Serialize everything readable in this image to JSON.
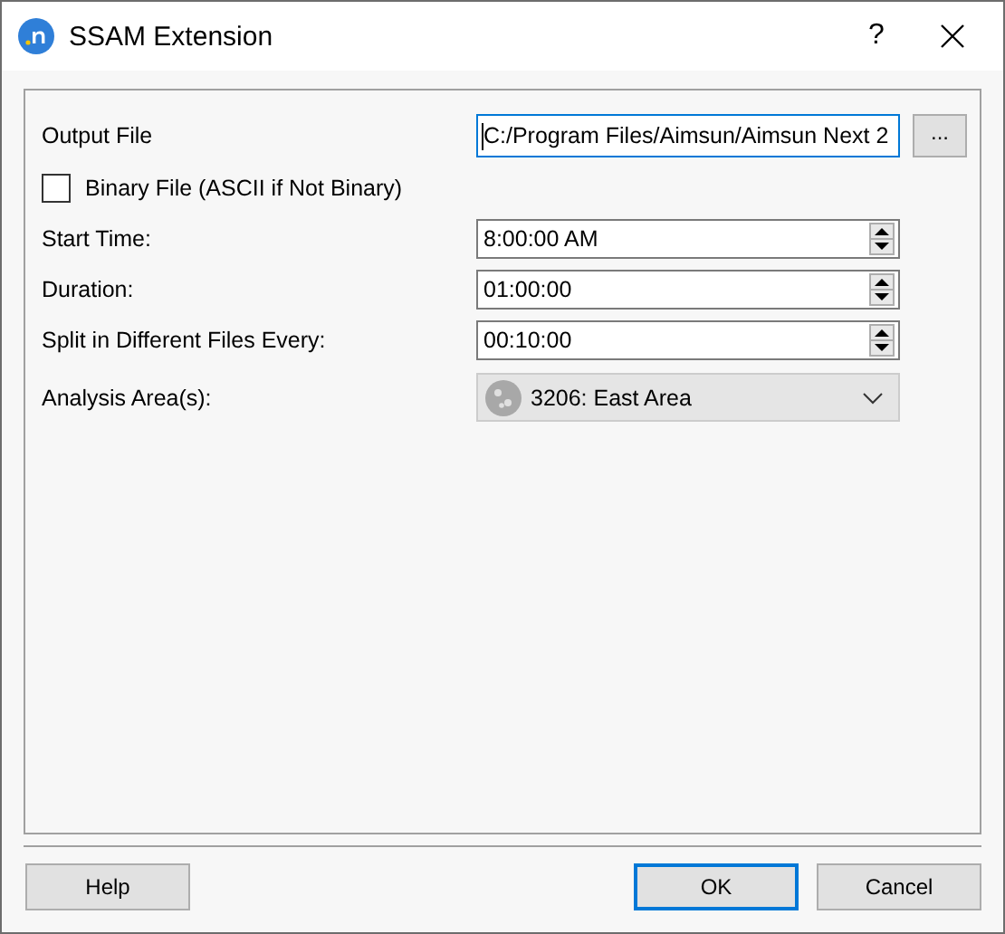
{
  "window": {
    "title": "SSAM Extension",
    "help_glyph": "?"
  },
  "output_file": {
    "label": "Output File",
    "value": "C:/Program Files/Aimsun/Aimsun Next 2",
    "focused": true,
    "browse": "..."
  },
  "binary_file": {
    "label": "Binary File (ASCII if Not Binary)",
    "checked": false
  },
  "fields": [
    {
      "kind": "spin",
      "label": "Start Time:",
      "value": "8:00:00 AM"
    },
    {
      "kind": "spin",
      "label": "Duration:",
      "value": "01:00:00"
    },
    {
      "kind": "spin",
      "label": "Split in Different Files Every:",
      "value": "00:10:00"
    },
    {
      "kind": "combo",
      "label": "Analysis Area(s):",
      "value": "3206: East Area"
    }
  ],
  "buttons": [
    {
      "label": "Help",
      "default": false
    },
    {
      "label": "OK",
      "default": true
    },
    {
      "label": "Cancel",
      "default": false
    }
  ]
}
